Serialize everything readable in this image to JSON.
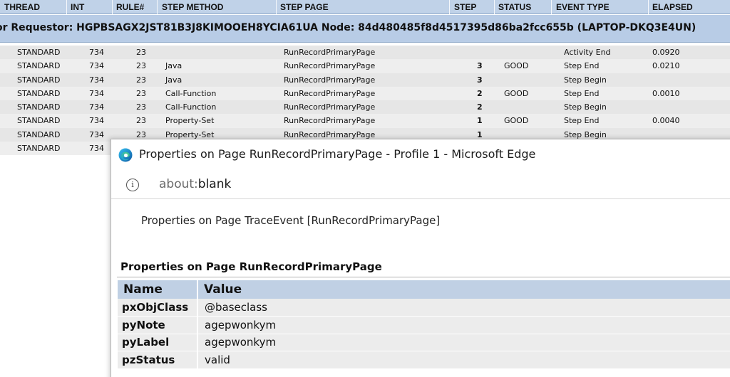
{
  "trace": {
    "headers": [
      "THREAD",
      "INT",
      "RULE#",
      "STEP METHOD",
      "STEP PAGE",
      "STEP",
      "STATUS",
      "EVENT TYPE",
      "ELAPSED"
    ],
    "requestor_text": "or Requestor: HGPBSAGX2JST81B3J8KIMOOEH8YCIA61UA Node: 84d480485f8d4517395d86ba2fcc655b (LAPTOP-DKQ3E4UN)",
    "rows": [
      {
        "thread": "STANDARD",
        "int": "734",
        "rule": "23",
        "method": "",
        "page": "RunRecordPrimaryPage",
        "step": "",
        "status": "",
        "event": "Activity End",
        "elapsed": "0.0920"
      },
      {
        "thread": "STANDARD",
        "int": "734",
        "rule": "23",
        "method": "Java",
        "page": "RunRecordPrimaryPage",
        "step": "3",
        "status": "GOOD",
        "event": "Step End",
        "elapsed": "0.0210"
      },
      {
        "thread": "STANDARD",
        "int": "734",
        "rule": "23",
        "method": "Java",
        "page": "RunRecordPrimaryPage",
        "step": "3",
        "status": "",
        "event": "Step Begin",
        "elapsed": ""
      },
      {
        "thread": "STANDARD",
        "int": "734",
        "rule": "23",
        "method": "Call-Function",
        "page": "RunRecordPrimaryPage",
        "step": "2",
        "status": "GOOD",
        "event": "Step End",
        "elapsed": "0.0010"
      },
      {
        "thread": "STANDARD",
        "int": "734",
        "rule": "23",
        "method": "Call-Function",
        "page": "RunRecordPrimaryPage",
        "step": "2",
        "status": "",
        "event": "Step Begin",
        "elapsed": ""
      },
      {
        "thread": "STANDARD",
        "int": "734",
        "rule": "23",
        "method": "Property-Set",
        "page": "RunRecordPrimaryPage",
        "step": "1",
        "status": "GOOD",
        "event": "Step End",
        "elapsed": "0.0040"
      },
      {
        "thread": "STANDARD",
        "int": "734",
        "rule": "23",
        "method": "Property-Set",
        "page": "RunRecordPrimaryPage",
        "step": "1",
        "status": "",
        "event": "Step Begin",
        "elapsed": ""
      },
      {
        "thread": "STANDARD",
        "int": "734",
        "rule": "",
        "method": "",
        "page": "",
        "step": "",
        "status": "",
        "event": "",
        "elapsed": ""
      }
    ]
  },
  "popup": {
    "window_title": "Properties on Page RunRecordPrimaryPage - Profile 1 - Microsoft Edge",
    "url_scheme": "about:",
    "url_host": "blank",
    "heading": "Properties on Page TraceEvent [RunRecordPrimaryPage]",
    "props_title": "Properties on Page RunRecordPrimaryPage",
    "table_headers": {
      "name": "Name",
      "value": "Value"
    },
    "properties": [
      {
        "name": "pxObjClass",
        "value": "@baseclass"
      },
      {
        "name": "pyNote",
        "value": "agepwonkym"
      },
      {
        "name": "pyLabel",
        "value": "agepwonkym"
      },
      {
        "name": "pzStatus",
        "value": "valid"
      }
    ],
    "icons": {
      "browser": "edge-icon",
      "site_info": "info-icon"
    }
  },
  "colors": {
    "header_bg": "#c0d2e8",
    "requestor_bg": "#b8cce6",
    "row_alt_bg": "#e6e6e6",
    "props_header_bg": "#c0d0e4",
    "props_row_bg": "#ececec"
  }
}
